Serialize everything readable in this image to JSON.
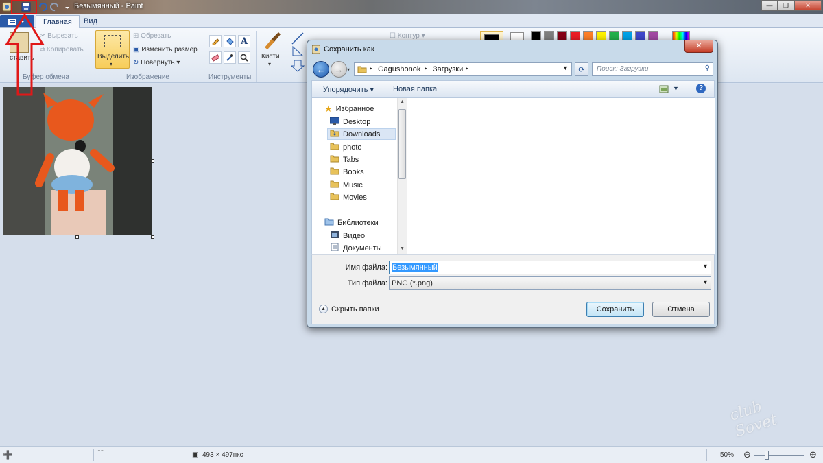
{
  "window": {
    "title": "Безымянный - Paint"
  },
  "ribbon": {
    "tabs": [
      "Главная",
      "Вид"
    ],
    "clipboard": {
      "paste": "ставить",
      "cut": "Вырезать",
      "copy": "Копировать",
      "label": "Буфер обмена"
    },
    "image": {
      "select": "Выделить",
      "crop": "Обрезать",
      "resize": "Изменить размер",
      "rotate": "Повернуть",
      "label": "Изображение"
    },
    "tools": {
      "label": "Инструменты"
    },
    "brushes": {
      "label": "Кисти"
    },
    "shapes": {
      "outline": "Контур"
    },
    "palette": [
      "#000000",
      "#7f7f7f",
      "#880015",
      "#ed1c24",
      "#ff7f27",
      "#fff200",
      "#22b14c",
      "#00a2e8",
      "#3f48cc",
      "#a349a4"
    ]
  },
  "dialog": {
    "title": "Сохранить как",
    "address": {
      "path": [
        "Gagushonok",
        "Загрузки"
      ]
    },
    "search": {
      "placeholder": "Поиск: Загрузки"
    },
    "toolbar": {
      "organize": "Упорядочить",
      "new_folder": "Новая папка"
    },
    "nav": {
      "favorites": "Избранное",
      "items": [
        "Desktop",
        "Downloads",
        "photo",
        "Tabs",
        "Books",
        "Music",
        "Movies"
      ],
      "libraries": "Библиотеки",
      "lib_items": [
        "Видео",
        "Документы"
      ]
    },
    "filename": {
      "label": "Имя файла:",
      "value": "Безымянный"
    },
    "filetype": {
      "label": "Тип файла:",
      "value": "PNG (*.png)"
    },
    "hide_folders": "Скрыть папки",
    "save": "Сохранить",
    "cancel": "Отмена"
  },
  "status": {
    "size": "493 × 497пкс",
    "zoom": "50%",
    "zoom_level": 0.5
  },
  "watermark": "club Sovet"
}
